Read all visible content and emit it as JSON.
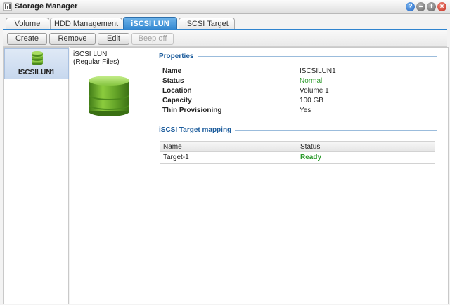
{
  "window": {
    "title": "Storage Manager"
  },
  "tabs": [
    {
      "label": "Volume"
    },
    {
      "label": "HDD Management"
    },
    {
      "label": "iSCSI LUN"
    },
    {
      "label": "iSCSI Target"
    }
  ],
  "toolbar": {
    "create_label": "Create",
    "remove_label": "Remove",
    "edit_label": "Edit",
    "beep_off_label": "Beep off"
  },
  "lun_list": [
    {
      "label": "ISCSILUN1"
    }
  ],
  "detail": {
    "type_line1": "iSCSI LUN",
    "type_line2": "(Regular Files)",
    "properties_title": "Properties",
    "properties": [
      {
        "label": "Name",
        "value": "ISCSILUN1"
      },
      {
        "label": "Status",
        "value": "Normal"
      },
      {
        "label": "Location",
        "value": "Volume 1"
      },
      {
        "label": "Capacity",
        "value": "100 GB"
      },
      {
        "label": "Thin Provisioning",
        "value": "Yes"
      }
    ],
    "mapping_title": "iSCSI Target mapping",
    "mapping_columns": [
      "Name",
      "Status"
    ],
    "mapping_rows": [
      {
        "name": "Target-1",
        "status": "Ready"
      }
    ]
  },
  "colors": {
    "accent": "#2f84cf",
    "section_title": "#1c5c9c",
    "status_ok": "#2c9a2c",
    "disk_green": "#6cab2c"
  },
  "icons": [
    "storage-manager-icon",
    "help-icon",
    "minimize-icon",
    "maximize-icon",
    "close-icon",
    "disk-stack-icon"
  ]
}
